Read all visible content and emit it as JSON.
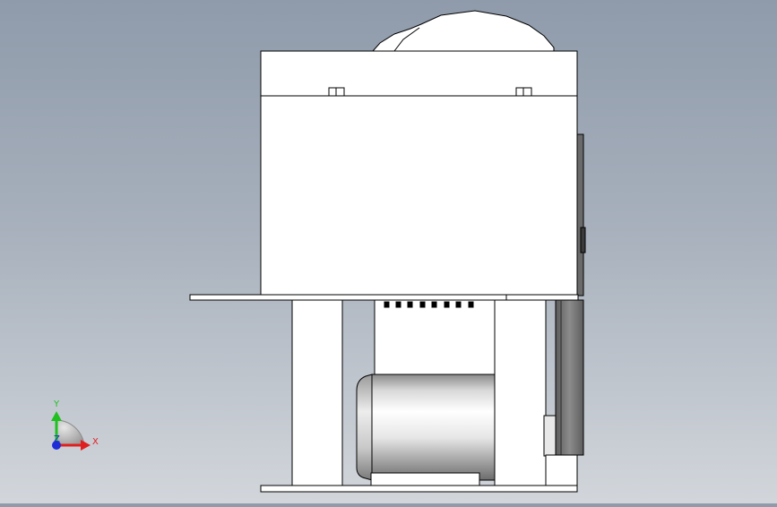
{
  "viewport": {
    "background_top": "#8f9bab",
    "background_bottom": "#d2d6db"
  },
  "model": {
    "line_color": "#000000",
    "body_fill": "#ffffff",
    "motor_shading": "cylindrical-gradient"
  },
  "triad": {
    "x_label": "X",
    "y_label": "Y",
    "z_label": "Z",
    "x_color": "#e02020",
    "y_color": "#20c020",
    "z_color": "#1e2cd8"
  }
}
